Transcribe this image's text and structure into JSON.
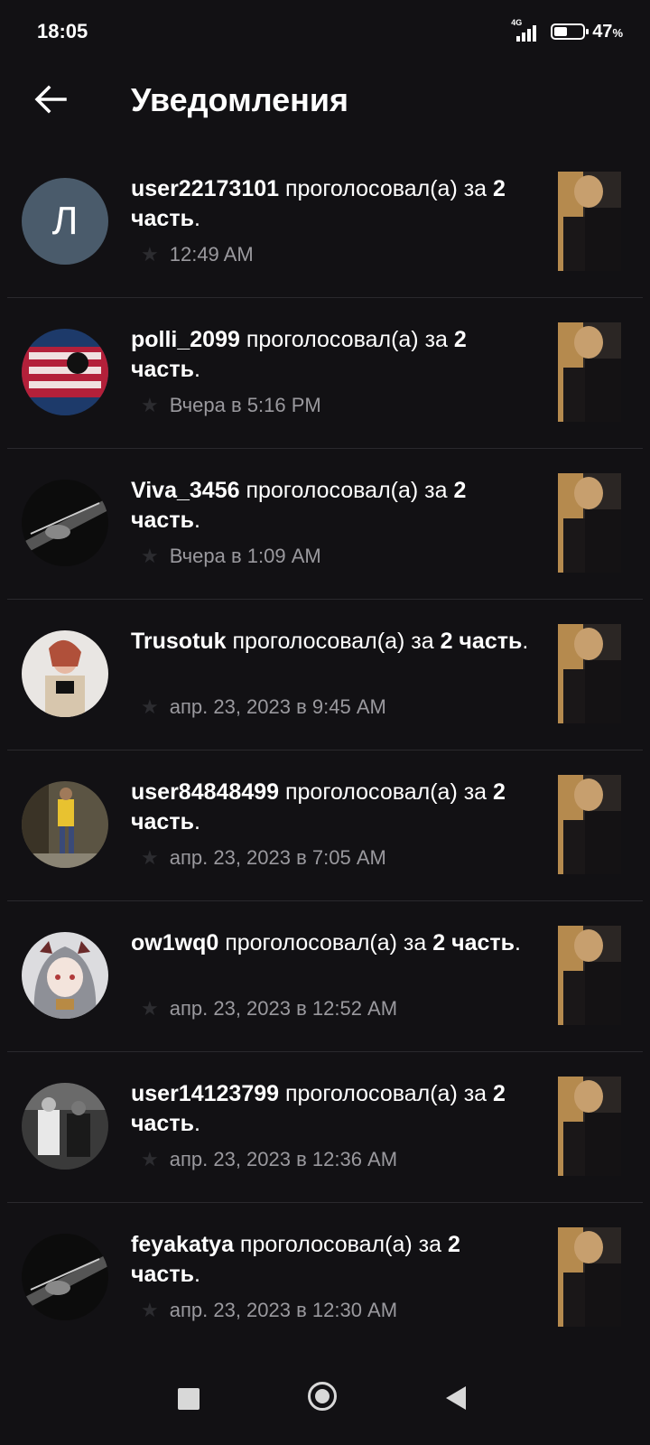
{
  "status_bar": {
    "time": "18:05",
    "network": "4G",
    "battery_percent": 47,
    "battery_label": "47",
    "battery_unit": "%"
  },
  "header": {
    "title": "Уведомления",
    "back_icon": "arrow-left-icon"
  },
  "notifications": [
    {
      "username": "user22173101",
      "action": " проголосовал(а) за ",
      "part": "2 часть",
      "suffix": ".",
      "time": "12:49 AM",
      "avatar_letter": "Л"
    },
    {
      "username": "polli_2099",
      "action": " проголосовал(а) за ",
      "part": "2 часть",
      "suffix": ".",
      "time": "Вчера в 5:16 PM"
    },
    {
      "username": "Viva_3456",
      "action": " проголосовал(а) за ",
      "part": "2 часть",
      "suffix": ".",
      "time": "Вчера в 1:09 AM"
    },
    {
      "username": "Trusotuk",
      "action": " проголосовал(а) за ",
      "part": "2 часть",
      "suffix": ".",
      "time": "апр. 23, 2023 в 9:45 AM"
    },
    {
      "username": "user84848499",
      "action": " проголосовал(а) за ",
      "part": "2 часть",
      "suffix": ".",
      "time": "апр. 23, 2023 в 7:05 AM"
    },
    {
      "username": "ow1wq0",
      "action": " проголосовал(а) за ",
      "part": "2 часть",
      "suffix": ".",
      "time": "апр. 23, 2023 в 12:52 AM"
    },
    {
      "username": "user14123799",
      "action": " проголосовал(а) за ",
      "part": "2 часть",
      "suffix": ".",
      "time": "апр. 23, 2023 в 12:36 AM"
    },
    {
      "username": "feyakatya",
      "action": " проголосовал(а) за ",
      "part": "2 часть",
      "suffix": ".",
      "time": "апр. 23, 2023 в 12:30 AM"
    }
  ],
  "nav_bar": {
    "recents_icon": "square-icon",
    "home_icon": "circle-icon",
    "back_icon": "triangle-back-icon"
  },
  "colors": {
    "background": "#121114",
    "divider": "#2a292d",
    "meta_text": "#9a999e",
    "letter_avatar_bg": "#4a5b6b"
  }
}
